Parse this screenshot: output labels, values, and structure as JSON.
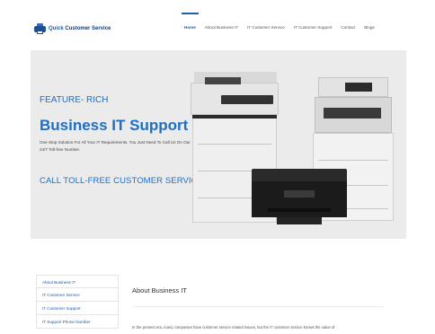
{
  "header": {
    "logo": {
      "quick": "Quick",
      "rest": " Customer Service"
    },
    "nav": [
      {
        "label": "Home",
        "active": true
      },
      {
        "label": "About Business IT",
        "active": false
      },
      {
        "label": "IT Customer Service",
        "active": false
      },
      {
        "label": "IT Customer Support",
        "active": false
      },
      {
        "label": "Contact",
        "active": false
      },
      {
        "label": "Blogs",
        "active": false
      }
    ]
  },
  "hero": {
    "eyebrow": "FEATURE- RICH",
    "headline": "Business IT Support",
    "subtext": "One Stop Solution For All Your IT Requirements. You Just Need To Call Us On Our 24/7 Toll-free Number.",
    "cta": "CALL TOLL-FREE CUSTOMER SERVICE"
  },
  "sidebar": {
    "items": [
      "About Business IT",
      "IT Customer Service",
      "IT Customer Support",
      "IT Support Phone Number"
    ]
  },
  "content": {
    "title": "About Business IT",
    "body": "In the present era, many companies have customer service related issues, but the IT customer service knows the value of"
  },
  "colors": {
    "brand": "#1d5fb0",
    "hero_accent": "#1d6fc4",
    "hero_bg": "#ebebeb"
  }
}
